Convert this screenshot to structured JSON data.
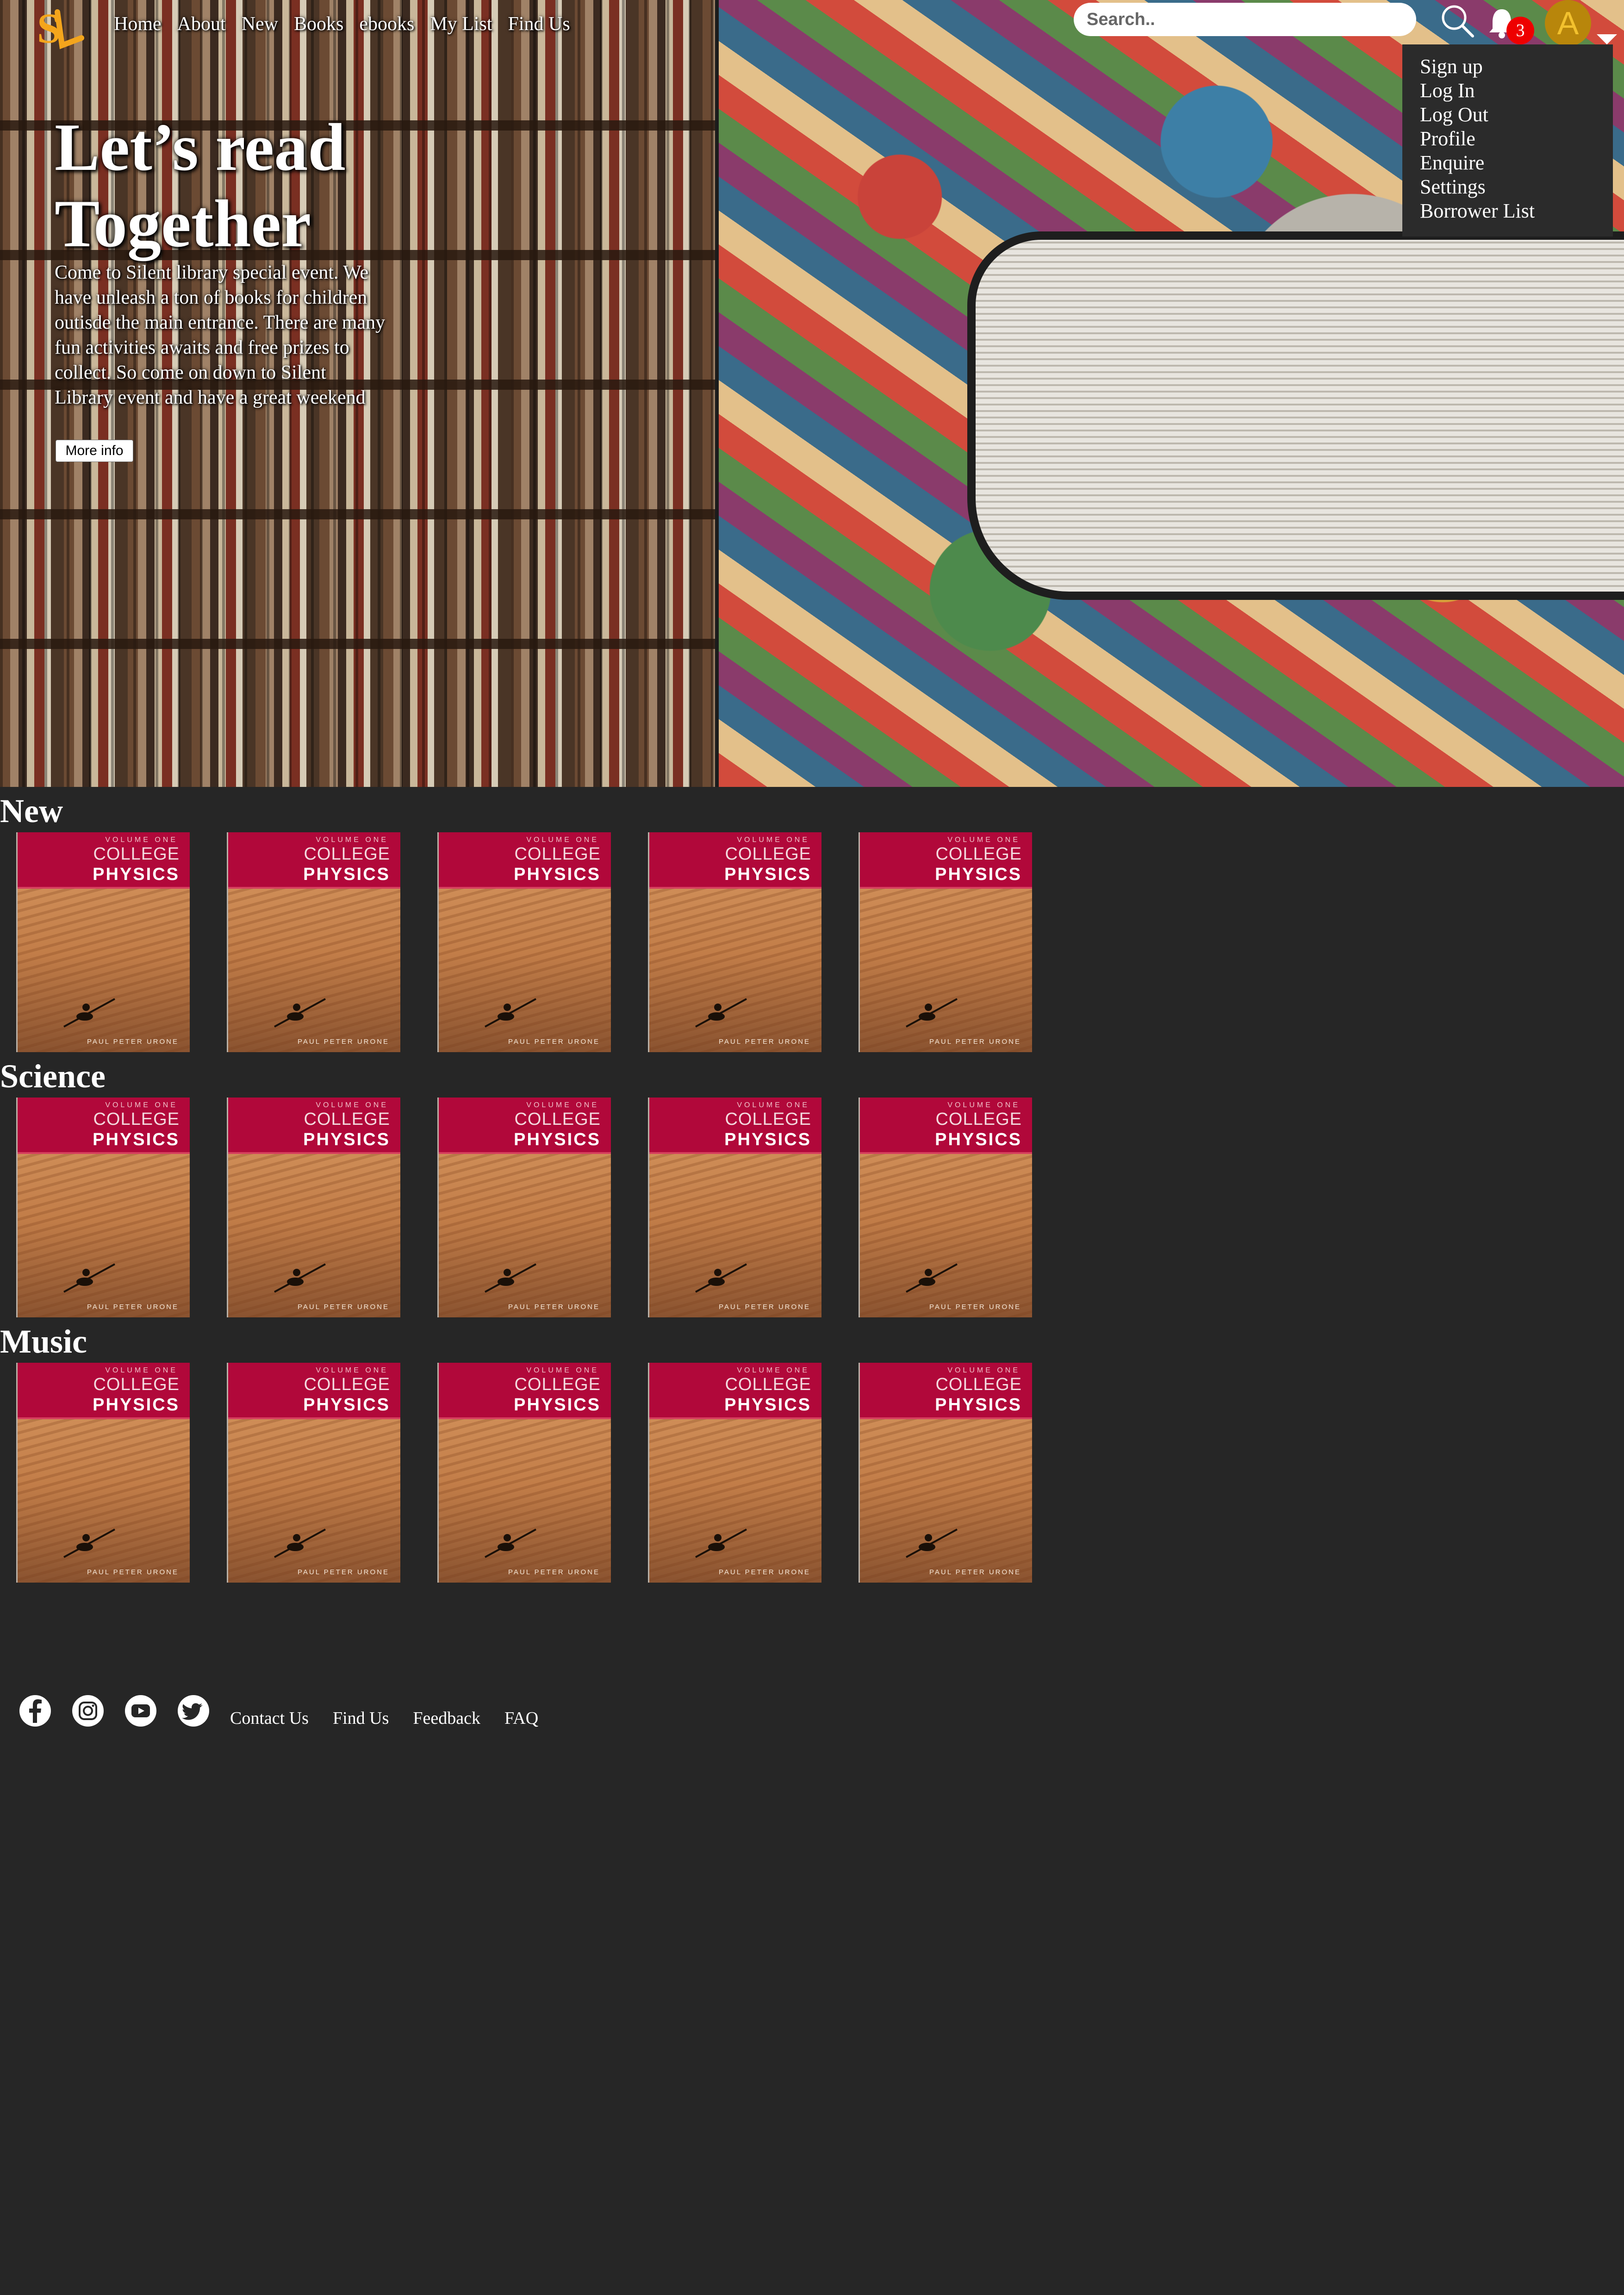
{
  "header": {
    "logo_text": "SL",
    "nav": [
      "Home",
      "About",
      "New",
      "Books",
      "ebooks",
      "My List",
      "Find Us"
    ],
    "search_placeholder": "Search..",
    "notification_count": "3",
    "avatar_letter": "A"
  },
  "account_menu": {
    "items": [
      "Sign up",
      "Log In",
      "Log Out",
      "Profile",
      "Enquire",
      "Settings",
      "Borrower List"
    ]
  },
  "hero": {
    "title": "Let’s read Together",
    "description": "Come to Silent library special event. We have unleash a ton of books for children outisde the main entrance. There are many fun activities awaits and free prizes to collect. So come on down to Silent Library event and have a great weekend",
    "button_label": "More info"
  },
  "book_cover": {
    "volume": "VOLUME ONE",
    "line1": "COLLEGE",
    "line2": "PHYSICS",
    "author": "PAUL PETER URONE"
  },
  "sections": [
    {
      "title": "New"
    },
    {
      "title": "Science"
    },
    {
      "title": "Music"
    }
  ],
  "footer": {
    "social_icons": [
      "facebook-icon",
      "instagram-icon",
      "youtube-icon",
      "twitter-icon"
    ],
    "links": [
      "Contact Us",
      "Find Us",
      "Feedback",
      "FAQ"
    ]
  },
  "colors": {
    "background": "#262626",
    "badge": "#e00000",
    "avatar": "#b8860b",
    "book_band": "#b1083a"
  }
}
